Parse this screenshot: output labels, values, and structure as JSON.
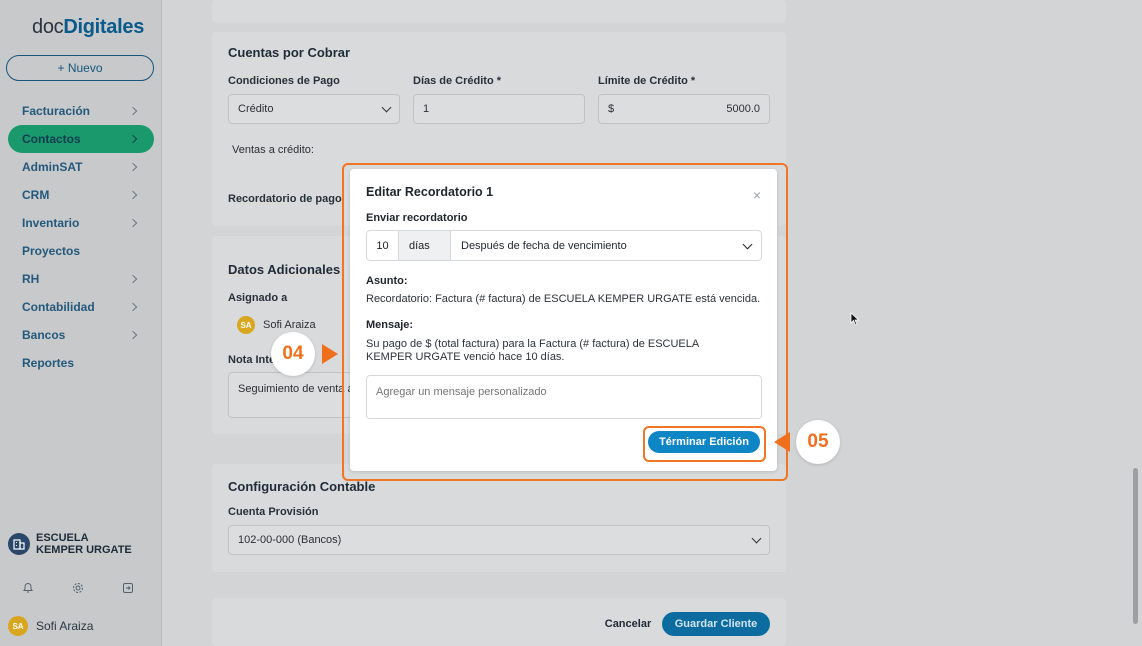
{
  "app": {
    "logo_prefix": "doc",
    "logo_brand": "Digitales",
    "new_button": "+ Nuevo"
  },
  "sidebar": {
    "items": [
      {
        "label": "Facturación",
        "chevron": true
      },
      {
        "label": "Contactos",
        "chevron": true,
        "active": true
      },
      {
        "label": "AdminSAT",
        "chevron": true
      },
      {
        "label": "CRM",
        "chevron": true
      },
      {
        "label": "Inventario",
        "chevron": true
      },
      {
        "label": "Proyectos",
        "chevron": false
      },
      {
        "label": "RH",
        "chevron": true
      },
      {
        "label": "Contabilidad",
        "chevron": true
      },
      {
        "label": "Bancos",
        "chevron": true
      },
      {
        "label": "Reportes",
        "chevron": false
      }
    ],
    "company": "ESCUELA KEMPER URGATE",
    "user_initials": "SA",
    "user_name": "Sofi Araiza"
  },
  "cuentas": {
    "title": "Cuentas por Cobrar",
    "cond_label": "Condiciones de Pago",
    "cond_value": "Crédito",
    "dias_label": "Días de Crédito *",
    "dias_value": "1",
    "limite_label": "Límite de Crédito *",
    "limite_currency": "$",
    "limite_value": "5000.0",
    "ventas_label": "Ventas a crédito:",
    "recordatorio_label": "Recordatorio de pago"
  },
  "adicionales": {
    "title": "Datos Adicionales",
    "asignado_label": "Asignado a",
    "asignado_initials": "SA",
    "asignado_value": "Sofi Araiza",
    "nota_label": "Nota Inte",
    "nota_value": "Seguimiento de venta a"
  },
  "contable": {
    "title": "Configuración Contable",
    "cuenta_label": "Cuenta Provisión",
    "cuenta_value": "102-00-000 (Bancos)"
  },
  "footer": {
    "cancel": "Cancelar",
    "save": "Guardar Cliente"
  },
  "modal": {
    "title": "Editar Recordatorio 1",
    "close": "×",
    "enviar_label": "Enviar recordatorio",
    "days_value": "10",
    "days_unit": "días",
    "when_value": "Después de fecha de vencimiento",
    "asunto_label": "Asunto:",
    "asunto_text": "Recordatorio: Factura (# factura) de ESCUELA KEMPER URGATE está vencida.",
    "mensaje_label": "Mensaje:",
    "mensaje_text": "Su pago de $ (total factura) para la Factura (# factura) de ESCUELA KEMPER URGATE venció hace 10 días.",
    "custom_placeholder": "Agregar un mensaje personalizado",
    "finish_button": "Términar Edición"
  },
  "steps": {
    "step_a": "04",
    "step_b": "05"
  },
  "colors": {
    "accent": "#ef6f1d",
    "primary": "#0e86c6",
    "active_nav": "#1a9a6c"
  }
}
